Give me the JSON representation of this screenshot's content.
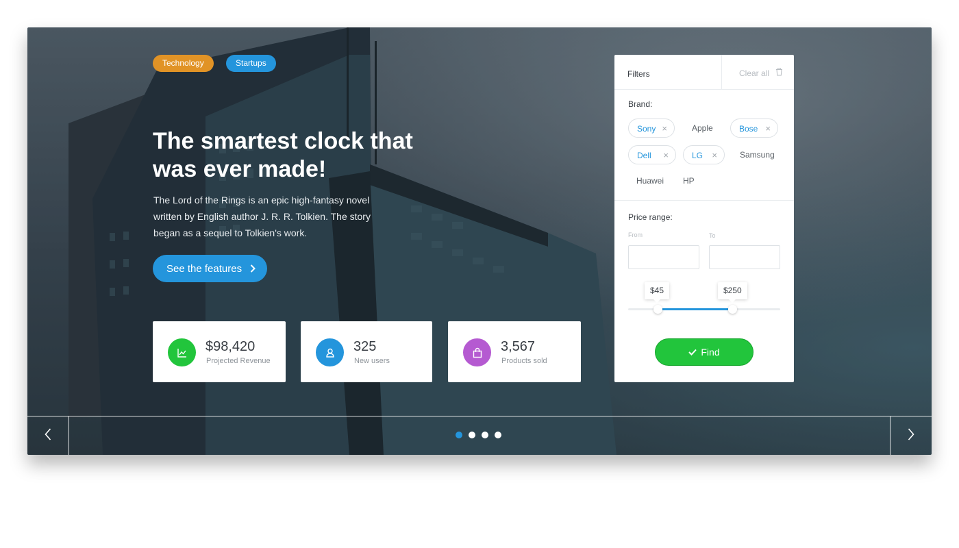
{
  "tags": [
    "Technology",
    "Startups"
  ],
  "hero": {
    "headline": "The smartest clock that was ever made!",
    "description": "The Lord of the Rings is an epic high-fantasy novel written by English author J. R. R. Tolkien. The story began as a sequel to Tolkien's work.",
    "cta_label": "See the features",
    "cta_icon": "chevron-right-icon"
  },
  "stats": [
    {
      "value": "$98,420",
      "label": "Projected Revenue",
      "icon": "chart-icon",
      "color": "#22c53c"
    },
    {
      "value": "325",
      "label": "New users",
      "icon": "user-icon",
      "color": "#2495dc"
    },
    {
      "value": "3,567",
      "label": "Products sold",
      "icon": "shopping-bag-icon",
      "color": "#b55ad1"
    }
  ],
  "filters": {
    "title": "Filters",
    "clear_label": "Clear all",
    "brand_label": "Brand:",
    "brands": [
      {
        "name": "Sony",
        "selected": true
      },
      {
        "name": "Apple",
        "selected": false
      },
      {
        "name": "Bose",
        "selected": true
      },
      {
        "name": "Dell",
        "selected": true
      },
      {
        "name": "LG",
        "selected": true
      },
      {
        "name": "Samsung",
        "selected": false
      },
      {
        "name": "Huawei",
        "selected": false
      },
      {
        "name": "HP",
        "selected": false
      }
    ],
    "price_label": "Price range:",
    "from_label": "From",
    "to_label": "To",
    "from_value": "",
    "to_value": "",
    "range_min_label": "$45",
    "range_max_label": "$250",
    "find_label": "Find"
  },
  "carousel": {
    "total_slides": 4,
    "active_index": 0
  },
  "colors": {
    "accent_blue": "#2495dc",
    "accent_orange": "#e19326",
    "find_green": "#22c53c"
  }
}
